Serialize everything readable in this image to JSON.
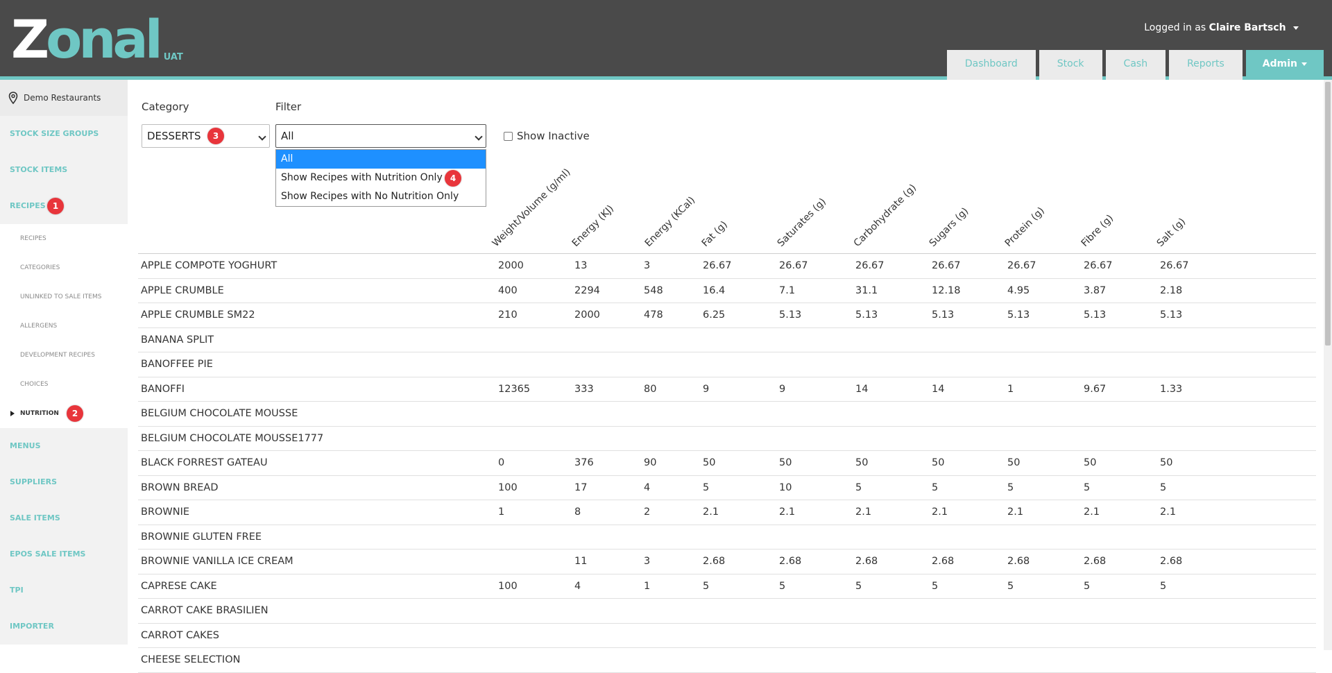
{
  "header": {
    "logo": "Zonal",
    "logo_suffix": "UAT",
    "user_prefix": "Logged in as",
    "user_name": "Claire Bartsch",
    "tabs": [
      "Dashboard",
      "Stock",
      "Cash",
      "Reports",
      "Admin"
    ]
  },
  "sidebar": {
    "location": "Demo Restaurants",
    "items": [
      {
        "label": "STOCK SIZE GROUPS"
      },
      {
        "label": "STOCK ITEMS"
      },
      {
        "label": "RECIPES"
      }
    ],
    "sub_items": [
      "RECIPES",
      "CATEGORIES",
      "UNLINKED TO SALE ITEMS",
      "ALLERGENS",
      "DEVELOPMENT RECIPES",
      "CHOICES",
      "NUTRITION"
    ],
    "items_after": [
      "MENUS",
      "SUPPLIERS",
      "SALE ITEMS",
      "EPOS SALE ITEMS",
      "TPI",
      "IMPORTER"
    ]
  },
  "badges": [
    "1",
    "2",
    "3",
    "4"
  ],
  "filters": {
    "category_label": "Category",
    "category_value": "DESSERTS",
    "filter_label": "Filter",
    "filter_value": "All",
    "show_inactive_label": "Show Inactive",
    "filter_options": [
      "All",
      "Show Recipes with Nutrition Only",
      "Show Recipes with No Nutrition Only"
    ]
  },
  "table": {
    "columns": [
      "Weight/Volume (g/ml)",
      "Energy (KJ)",
      "Energy (KCal)",
      "Fat (g)",
      "Saturates (g)",
      "Carbohydrate (g)",
      "Sugars (g)",
      "Protein (g)",
      "Fibre (g)",
      "Salt (g)"
    ],
    "rows": [
      {
        "name": "APPLE COMPOTE YOGHURT",
        "values": [
          "2000",
          "13",
          "3",
          "26.67",
          "26.67",
          "26.67",
          "26.67",
          "26.67",
          "26.67",
          "26.67"
        ]
      },
      {
        "name": "APPLE CRUMBLE",
        "values": [
          "400",
          "2294",
          "548",
          "16.4",
          "7.1",
          "31.1",
          "12.18",
          "4.95",
          "3.87",
          "2.18"
        ]
      },
      {
        "name": "APPLE CRUMBLE SM22",
        "values": [
          "210",
          "2000",
          "478",
          "6.25",
          "5.13",
          "5.13",
          "5.13",
          "5.13",
          "5.13",
          "5.13"
        ]
      },
      {
        "name": "BANANA SPLIT",
        "values": [
          "",
          "",
          "",
          "",
          "",
          "",
          "",
          "",
          "",
          ""
        ]
      },
      {
        "name": "BANOFFEE PIE",
        "values": [
          "",
          "",
          "",
          "",
          "",
          "",
          "",
          "",
          "",
          ""
        ]
      },
      {
        "name": "BANOFFI",
        "values": [
          "12365",
          "333",
          "80",
          "9",
          "9",
          "14",
          "14",
          "1",
          "9.67",
          "1.33"
        ]
      },
      {
        "name": "BELGIUM CHOCOLATE MOUSSE",
        "values": [
          "",
          "",
          "",
          "",
          "",
          "",
          "",
          "",
          "",
          ""
        ]
      },
      {
        "name": "BELGIUM CHOCOLATE MOUSSE1777",
        "values": [
          "",
          "",
          "",
          "",
          "",
          "",
          "",
          "",
          "",
          ""
        ]
      },
      {
        "name": "BLACK FORREST GATEAU",
        "values": [
          "0",
          "376",
          "90",
          "50",
          "50",
          "50",
          "50",
          "50",
          "50",
          "50"
        ]
      },
      {
        "name": "BROWN BREAD",
        "values": [
          "100",
          "17",
          "4",
          "5",
          "10",
          "5",
          "5",
          "5",
          "5",
          "5"
        ]
      },
      {
        "name": "BROWNIE",
        "values": [
          "1",
          "8",
          "2",
          "2.1",
          "2.1",
          "2.1",
          "2.1",
          "2.1",
          "2.1",
          "2.1"
        ]
      },
      {
        "name": "BROWNIE GLUTEN FREE",
        "values": [
          "",
          "",
          "",
          "",
          "",
          "",
          "",
          "",
          "",
          ""
        ]
      },
      {
        "name": "BROWNIE VANILLA ICE CREAM",
        "values": [
          "",
          "11",
          "3",
          "2.68",
          "2.68",
          "2.68",
          "2.68",
          "2.68",
          "2.68",
          "2.68"
        ]
      },
      {
        "name": "CAPRESE CAKE",
        "values": [
          "100",
          "4",
          "1",
          "5",
          "5",
          "5",
          "5",
          "5",
          "5",
          "5"
        ]
      },
      {
        "name": "CARROT CAKE BRASILIEN",
        "values": [
          "",
          "",
          "",
          "",
          "",
          "",
          "",
          "",
          "",
          ""
        ]
      },
      {
        "name": "CARROT CAKES",
        "values": [
          "",
          "",
          "",
          "",
          "",
          "",
          "",
          "",
          "",
          ""
        ]
      },
      {
        "name": "CHEESE SELECTION",
        "values": [
          "",
          "",
          "",
          "",
          "",
          "",
          "",
          "",
          "",
          ""
        ]
      }
    ]
  },
  "colors": {
    "accent": "#6fc7c4",
    "header_bg": "#4a4a4a",
    "badge": "#e8353b",
    "selected": "#1e90ff"
  }
}
